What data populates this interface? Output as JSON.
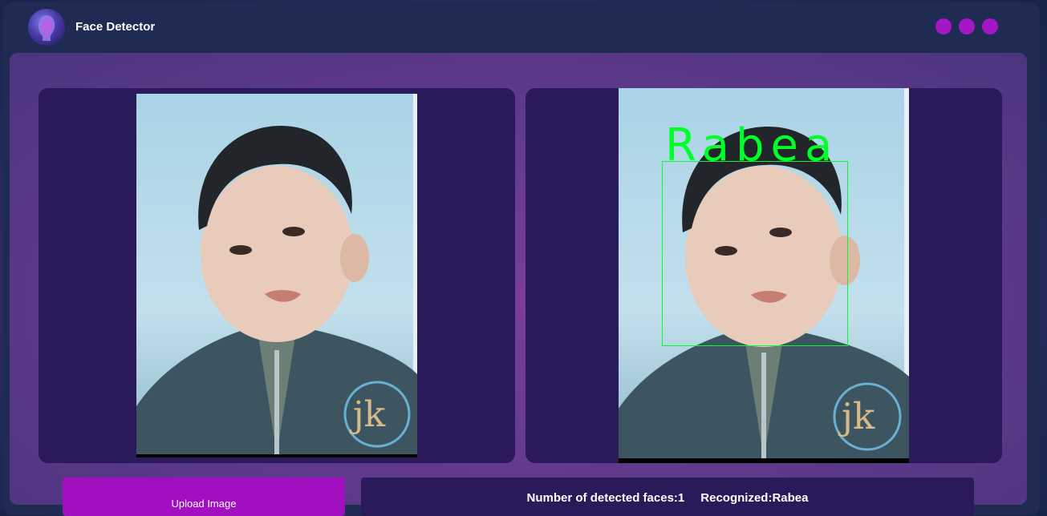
{
  "header": {
    "app_title": "Face Detector",
    "logo_icon": "face-logo-icon",
    "window_controls": [
      "dot-icon",
      "dot-icon",
      "dot-icon"
    ],
    "accent_color": "#a318c4"
  },
  "images": {
    "original_label": "original-photo",
    "result_label": "result-photo",
    "detected_name": "Rabea",
    "box_color": "#00ff2a"
  },
  "actions": {
    "upload_label": "Upload Image"
  },
  "status": {
    "faces_text": "Number of detected faces:1",
    "recognized_text": "Recognized:Rabea"
  }
}
